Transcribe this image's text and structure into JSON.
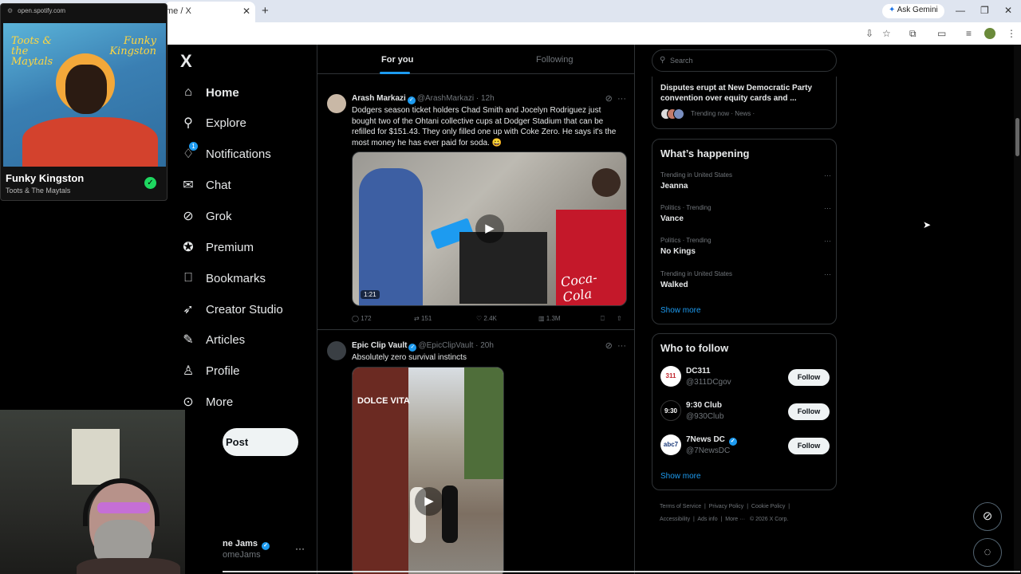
{
  "browser": {
    "tab_title": "me / X",
    "tab_close": "✕",
    "new_tab": "+",
    "gemini_label": "Ask Gemini",
    "minimize": "—",
    "restore": "❐",
    "close": "✕"
  },
  "spotify": {
    "url": "open.spotify.com",
    "album_text_left": "Toots & the Maytals",
    "album_text_right": "Funky Kingston",
    "track": "Funky Kingston",
    "artist": "Toots & The Maytals"
  },
  "nav": {
    "logo": "X",
    "items": [
      {
        "label": "Home",
        "icon": "home-icon"
      },
      {
        "label": "Explore",
        "icon": "search-icon"
      },
      {
        "label": "Notifications",
        "icon": "bell-icon"
      },
      {
        "label": "Chat",
        "icon": "mail-icon"
      },
      {
        "label": "Grok",
        "icon": "grok-icon"
      },
      {
        "label": "Premium",
        "icon": "verified-icon"
      },
      {
        "label": "Bookmarks",
        "icon": "bookmark-icon"
      },
      {
        "label": "Creator Studio",
        "icon": "rocket-icon"
      },
      {
        "label": "Articles",
        "icon": "articles-icon"
      },
      {
        "label": "Profile",
        "icon": "person-icon"
      },
      {
        "label": "More",
        "icon": "more-circle-icon"
      }
    ],
    "notif_badge": "1",
    "post": "Post",
    "me_name": "ne Jams",
    "me_handle": "omeJams",
    "more": "···"
  },
  "feed": {
    "tab_for_you": "For you",
    "tab_following": "Following",
    "tweets": [
      {
        "name": "Arash Markazi",
        "handle": "@ArashMarkazi",
        "time": "· 12h",
        "text": "Dodgers season ticket holders Chad Smith and Jocelyn Rodriguez just bought two of the Ohtani collective cups at Dodger Stadium that can be refilled for $151.43. They only filled one up with Coke Zero. He says it's the most money he has ever paid for soda. 😀",
        "duration": "1:21",
        "replies": "172",
        "reposts": "151",
        "likes": "2.4K",
        "views": "1.3M",
        "sign": "Coca-Cola"
      },
      {
        "name": "Epic Clip Vault",
        "handle": "@EpicClipVault",
        "time": "· 20h",
        "text": "Absolutely zero survival instincts",
        "sign": "DOLCE VITA"
      }
    ]
  },
  "right": {
    "search_placeholder": "Search",
    "news_title": "Disputes erupt at New Democratic Party convention over equity cards and ...",
    "news_meta": "Trending now · News ·",
    "whats_happening": "What’s happening",
    "trends": [
      {
        "category": "Trending in United States",
        "name": "Jeanna"
      },
      {
        "category": "Politics · Trending",
        "name": "Vance"
      },
      {
        "category": "Politics · Trending",
        "name": "No Kings"
      },
      {
        "category": "Trending in United States",
        "name": "Walked"
      }
    ],
    "show_more": "Show more",
    "who_to_follow": "Who to follow",
    "follow_suggestions": [
      {
        "name": "DC311",
        "handle": "@311DCgov",
        "avatar": "311",
        "button": "Follow"
      },
      {
        "name": "9:30 Club",
        "handle": "@930Club",
        "avatar": "9:30",
        "button": "Follow"
      },
      {
        "name": "7News DC",
        "handle": "@7NewsDC",
        "avatar": "abc7",
        "button": "Follow"
      }
    ],
    "show_more_2": "Show more",
    "footer": [
      "Terms of Service",
      "Privacy Policy",
      "Cookie Policy",
      "Accessibility",
      "Ads info",
      "More ···",
      "© 2026 X Corp."
    ]
  }
}
